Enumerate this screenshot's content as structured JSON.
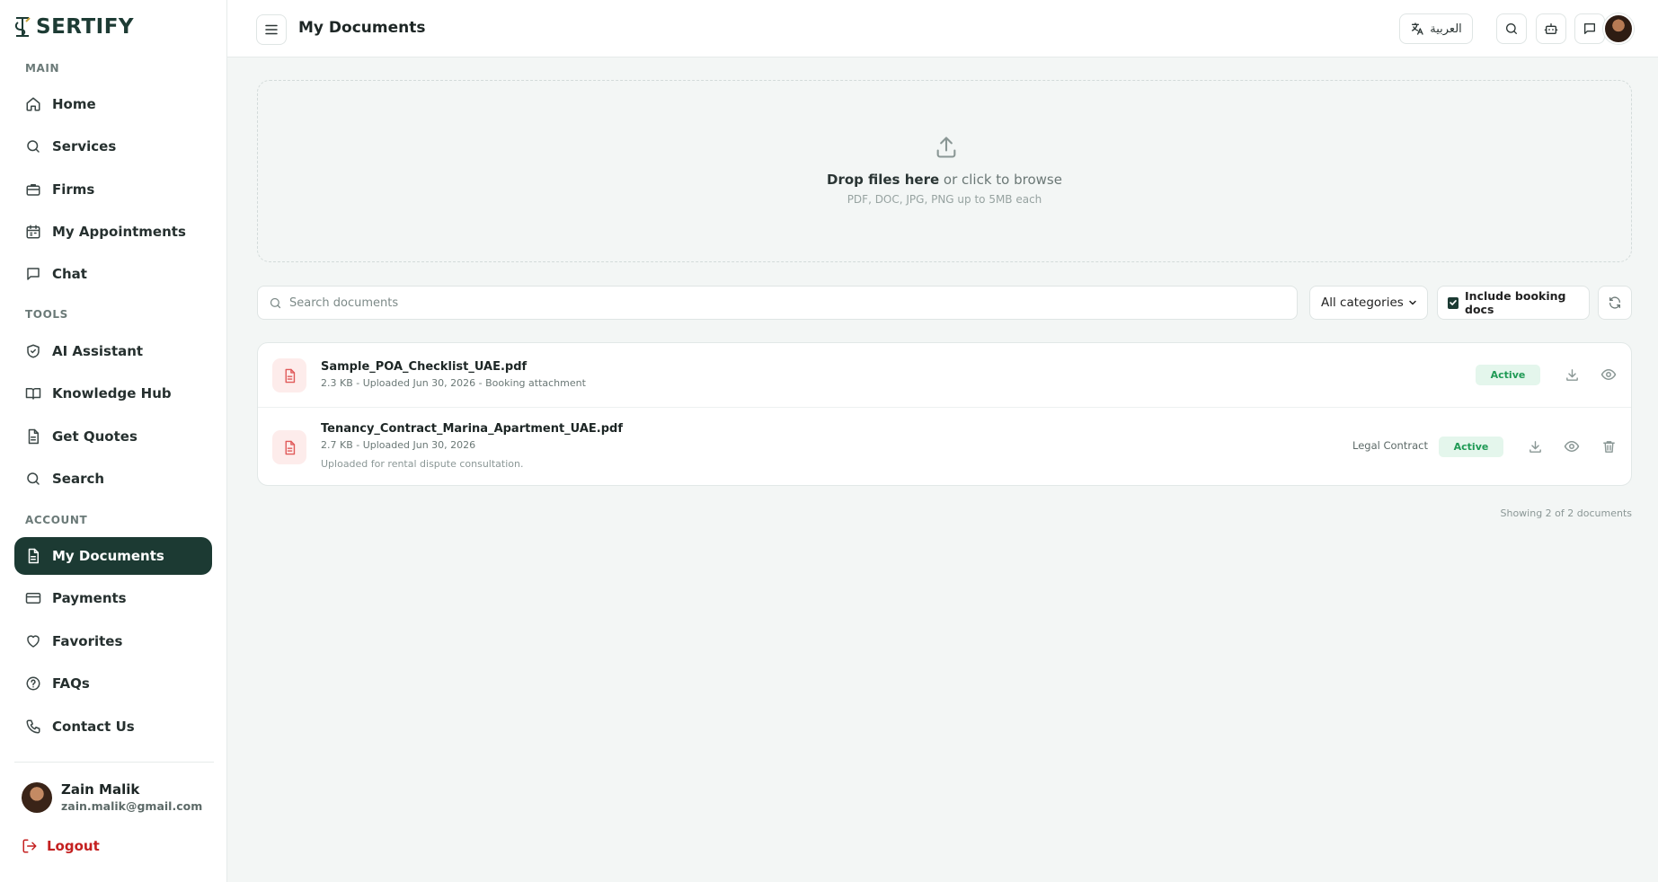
{
  "brand": {
    "name": "SERTIFY"
  },
  "header": {
    "title": "My Documents",
    "language_button": "العربية"
  },
  "sidebar": {
    "sections": {
      "main": "MAIN",
      "tools": "TOOLS",
      "account": "ACCOUNT"
    },
    "items": [
      {
        "label": "Home",
        "icon": "home-icon"
      },
      {
        "label": "Services",
        "icon": "search-icon"
      },
      {
        "label": "Firms",
        "icon": "briefcase-icon"
      },
      {
        "label": "My Appointments",
        "icon": "calendar-icon"
      },
      {
        "label": "Chat",
        "icon": "chat-icon"
      },
      {
        "label": "AI Assistant",
        "icon": "shield-check-icon"
      },
      {
        "label": "Knowledge Hub",
        "icon": "book-icon"
      },
      {
        "label": "Get Quotes",
        "icon": "document-icon"
      },
      {
        "label": "Search",
        "icon": "search-icon"
      },
      {
        "label": "My Documents",
        "icon": "document-icon",
        "active": true
      },
      {
        "label": "Payments",
        "icon": "credit-card-icon"
      },
      {
        "label": "Favorites",
        "icon": "heart-icon"
      },
      {
        "label": "FAQs",
        "icon": "help-circle-icon"
      },
      {
        "label": "Contact Us",
        "icon": "phone-icon"
      }
    ],
    "user": {
      "name": "Zain Malik",
      "email": "zain.malik@gmail.com"
    },
    "logout": "Logout"
  },
  "upload": {
    "drop_bold": "Drop files here",
    "drop_rest": " or click to browse",
    "hint": "PDF, DOC, JPG, PNG up to 5MB each"
  },
  "filters": {
    "search_placeholder": "Search documents",
    "category_selected": "All categories",
    "include_booking_label": "Include booking docs",
    "include_booking_checked": true
  },
  "documents": [
    {
      "name": "Sample_POA_Checklist_UAE.pdf",
      "meta": "2.3 KB - Uploaded Jun 30, 2026 - Booking attachment",
      "status": "Active"
    },
    {
      "name": "Tenancy_Contract_Marina_Apartment_UAE.pdf",
      "meta": "2.7 KB - Uploaded Jun 30, 2026",
      "note": "Uploaded for rental dispute consultation.",
      "category": "Legal Contract",
      "status": "Active"
    }
  ],
  "footer": {
    "showing": "Showing 2 of 2 documents"
  },
  "colors": {
    "primary": "#1c3a33",
    "danger": "#c42020",
    "status_active_bg": "#e4f6ec",
    "status_active_text": "#1f9a55",
    "file_icon_bg": "#fdeceb",
    "file_icon_fg": "#e05a5a"
  }
}
